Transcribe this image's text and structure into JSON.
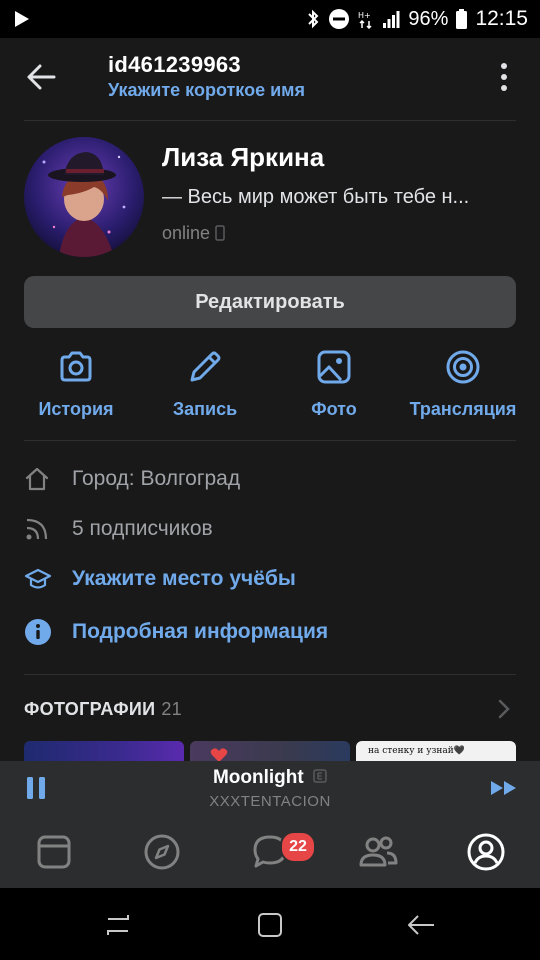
{
  "status_bar": {
    "battery": "96%",
    "time": "12:15"
  },
  "header": {
    "title": "id461239963",
    "subtitle": "Укажите короткое имя"
  },
  "profile": {
    "name": "Лиза Яркина",
    "status": "— Весь мир может быть тебе н...",
    "online": "online"
  },
  "edit_button": "Редактировать",
  "actions": [
    {
      "label": "История",
      "icon": "camera-icon"
    },
    {
      "label": "Запись",
      "icon": "pencil-icon"
    },
    {
      "label": "Фото",
      "icon": "image-icon"
    },
    {
      "label": "Трансляция",
      "icon": "broadcast-icon"
    }
  ],
  "info": {
    "city": "Город: Волгоград",
    "followers": "5 подписчиков",
    "education": "Укажите место учёбы",
    "details": "Подробная информация"
  },
  "photos": {
    "title": "ФОТОГРАФИИ",
    "count": "21",
    "thumb3_text": "на стенку и узнай🖤"
  },
  "player": {
    "title": "Moonlight",
    "artist": "XXXTENTACION"
  },
  "tabbar": {
    "messages_badge": "22"
  },
  "colors": {
    "accent": "#71aaeb",
    "background": "#19191a",
    "badge": "#e64646"
  }
}
